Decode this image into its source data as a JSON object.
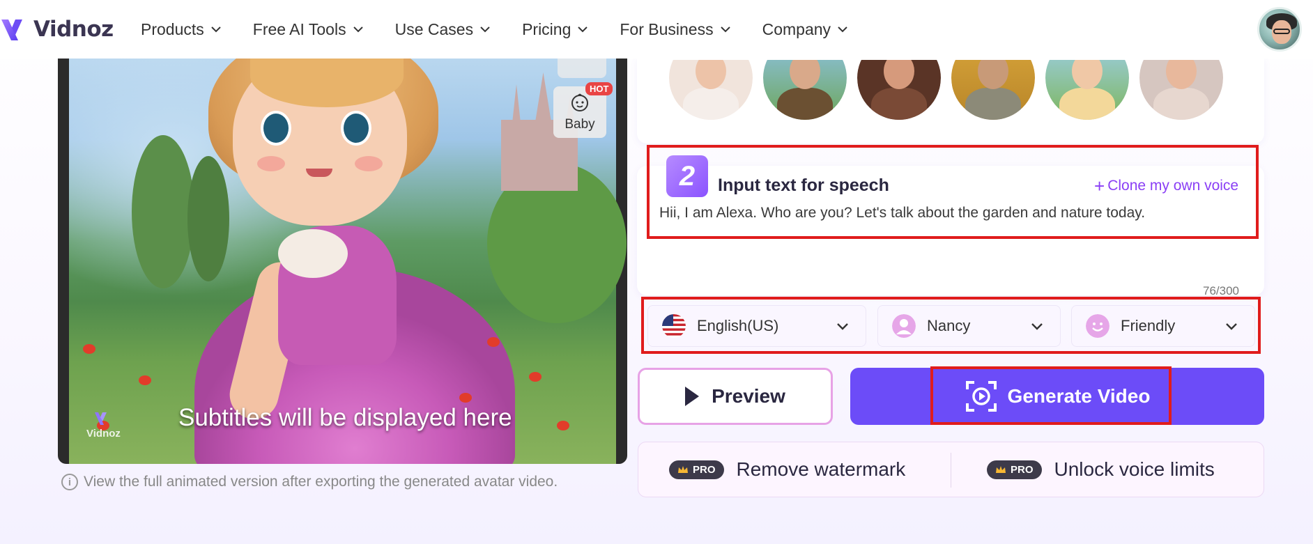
{
  "header": {
    "logo_text": "Vidnoz",
    "nav": [
      "Products",
      "Free AI Tools",
      "Use Cases",
      "Pricing",
      "For Business",
      "Company"
    ],
    "user_avatar": "user-avatar"
  },
  "preview": {
    "badge_label": "Baby",
    "badge_hot": "HOT",
    "subtitle": "Subtitles will be displayed here",
    "watermark": "Vidnoz",
    "note": "View the full animated version after exporting the generated avatar video."
  },
  "speech": {
    "step": "2",
    "title": "Input text for speech",
    "clone_label": "Clone my own voice",
    "text": "Hii, I am Alexa. Who are you? Let's talk about the garden and nature today.",
    "counter": "76/300",
    "language": "English(US)",
    "voice": "Nancy",
    "style": "Friendly"
  },
  "actions": {
    "preview_label": "Preview",
    "generate_label": "Generate Video"
  },
  "pro": {
    "badge": "PRO",
    "remove_watermark": "Remove watermark",
    "unlock_voice": "Unlock voice limits"
  },
  "colors": {
    "accent": "#6c4cf8",
    "link": "#8a3ff5",
    "highlight": "#e01c1c"
  }
}
